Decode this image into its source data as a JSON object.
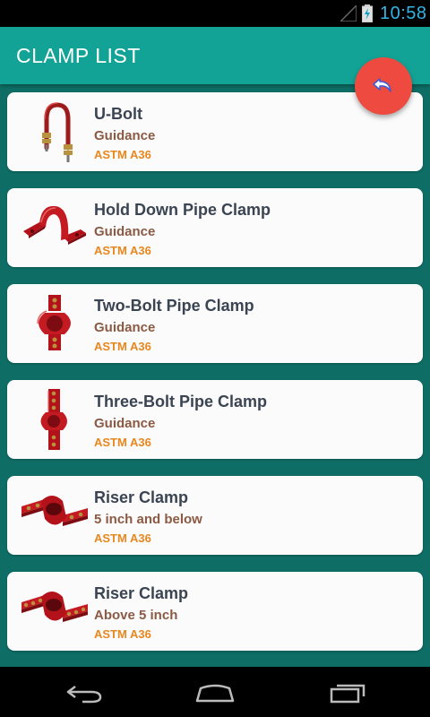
{
  "status_bar": {
    "time": "10:58",
    "icons": [
      "signal-icon",
      "battery-charging-icon"
    ]
  },
  "app_bar": {
    "title": "CLAMP LIST"
  },
  "fab": {
    "icon": "undo-back-icon",
    "color": "#ef4a3f"
  },
  "colors": {
    "background": "#0e6e66",
    "app_bar": "#12a396",
    "name_text": "#3a4452",
    "sub_text": "#8a5a44",
    "material_text": "#e8871e",
    "clamp_red": "#b3121b"
  },
  "clamps": [
    {
      "name": "U-Bolt",
      "sub": "Guidance",
      "material": "ASTM A36",
      "image": "u-bolt-image"
    },
    {
      "name": "Hold Down Pipe Clamp",
      "sub": "Guidance",
      "material": "ASTM A36",
      "image": "hold-down-clamp-image"
    },
    {
      "name": "Two-Bolt Pipe Clamp",
      "sub": "Guidance",
      "material": "ASTM A36",
      "image": "two-bolt-clamp-image"
    },
    {
      "name": "Three-Bolt Pipe Clamp",
      "sub": "Guidance",
      "material": "ASTM A36",
      "image": "three-bolt-clamp-image"
    },
    {
      "name": "Riser Clamp",
      "sub": "5 inch and below",
      "material": "ASTM A36",
      "image": "riser-clamp-image"
    },
    {
      "name": "Riser Clamp",
      "sub": "Above 5 inch",
      "material": "ASTM A36",
      "image": "riser-clamp-image"
    }
  ],
  "nav_bar": {
    "buttons": [
      "back-icon",
      "home-icon",
      "recents-icon"
    ]
  }
}
